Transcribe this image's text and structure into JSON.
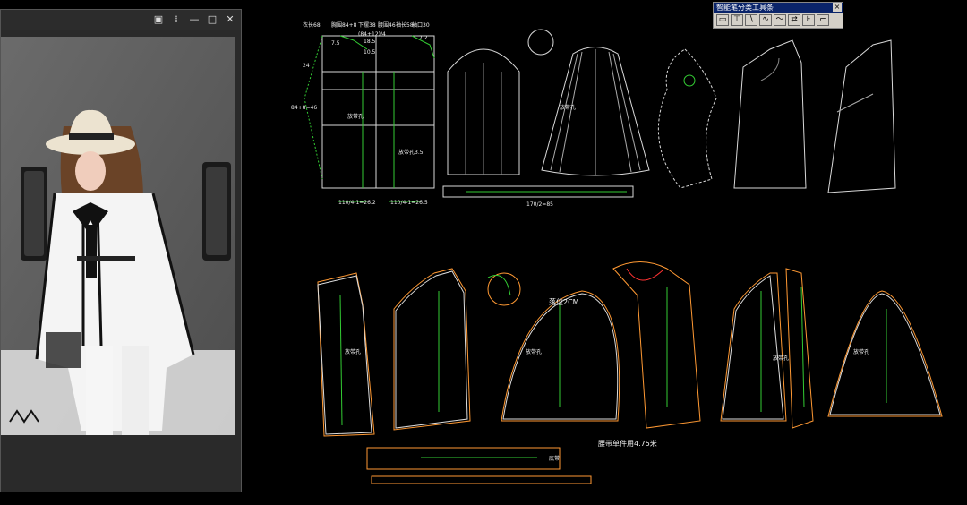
{
  "viewer": {
    "controls": [
      "▣",
      "⁞",
      "—",
      "□",
      "✕"
    ]
  },
  "palette": {
    "title": "智能笔分类工具条",
    "close": "×",
    "tools": [
      "▭",
      "⊤",
      "∖",
      "∿",
      "〜",
      "⇄",
      "⊦",
      "⌐"
    ]
  },
  "cad": {
    "top_dims": {
      "chest": "胸围84+8",
      "length": "衣长68",
      "hem": "下摆38",
      "waist": "腰围46",
      "shoulder": "袖长58",
      "cuff": "袖口30",
      "chest_line": "(84+12)/4",
      "sample_a": "18.5",
      "sample_b": "10.5",
      "sample_c": "7.5",
      "sample_d": "7.2",
      "bottom_left": "110/4-1=26.2",
      "bottom_right": "110/4-1=26.5",
      "band_length": "170/2=85",
      "left_side_a": "24",
      "left_side_b": "84+8=46"
    },
    "labels": {
      "placket": "放带孔",
      "placket2": "放带孔3.5",
      "offset": "落位2CM",
      "belt_note": "腰带单件用4.75米",
      "belt_small": "底带"
    }
  }
}
